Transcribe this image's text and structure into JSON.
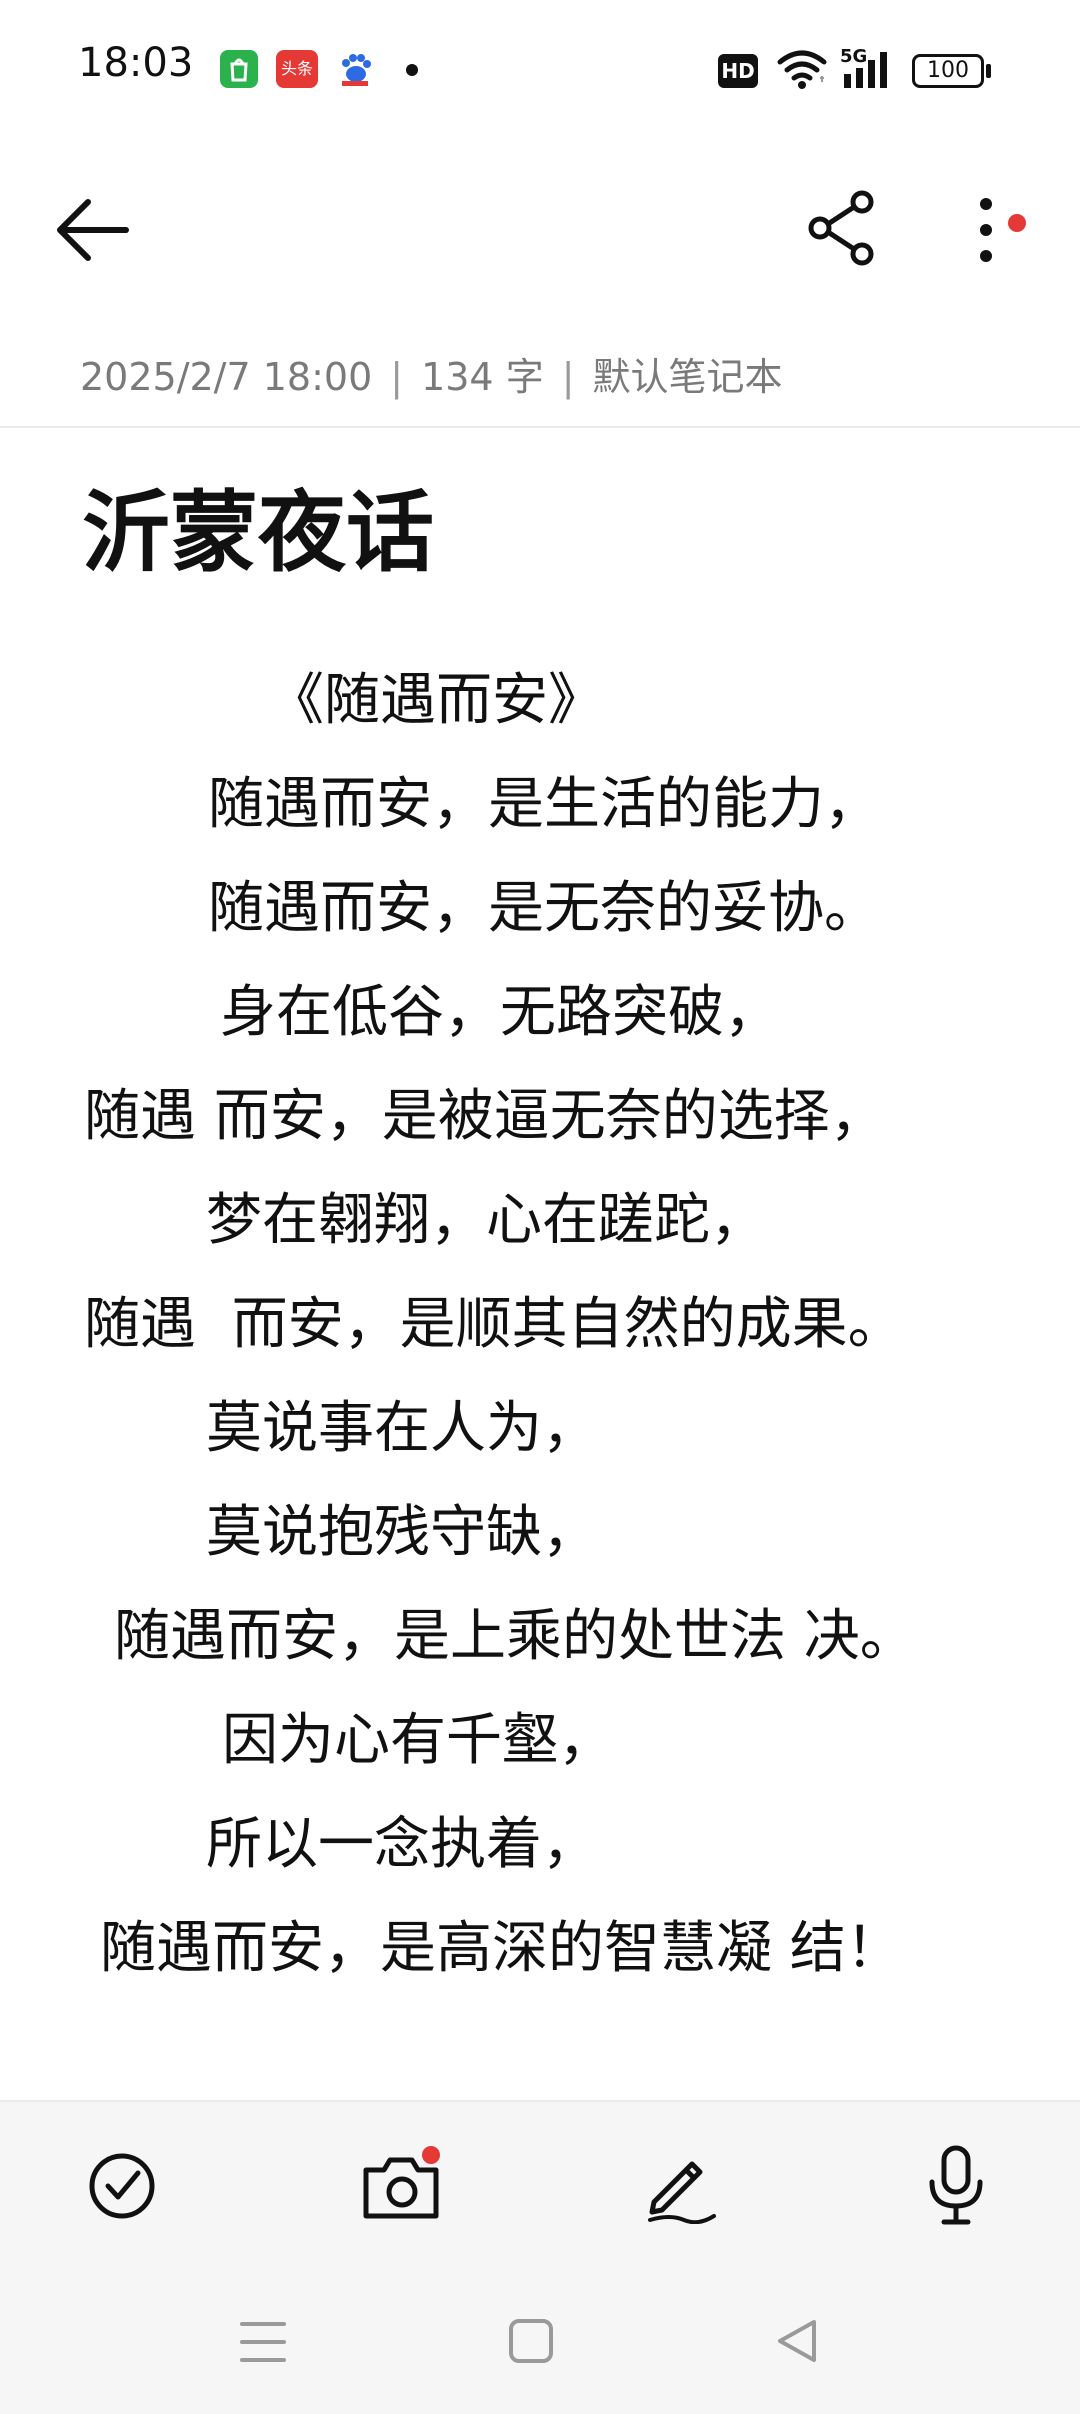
{
  "status_bar": {
    "time": "18:03",
    "app_icons": [
      "shopping-bag-icon",
      "toutiao-app-icon",
      "baidu-app-icon"
    ],
    "toutiao_label": "头条",
    "hd_label": "HD",
    "network_label": "5G",
    "battery_label": "100"
  },
  "note": {
    "date": "2025/2/7 18:00",
    "word_count": "134 字",
    "notebook": "默认笔记本",
    "title": "沂蒙夜话",
    "lines": [
      "《随遇而安》",
      "随遇而安，是生活的能力，",
      "随遇而安，是无奈的妥协。",
      "身在低谷，无路突破，",
      "随遇 而安，是被逼无奈的选择，",
      "梦在翱翔，心在蹉跎，",
      "随遇  而安，是顺其自然的成果。",
      "莫说事在人为，",
      "莫说抱残守缺，",
      "随遇而安，是上乘的处世法 决。",
      "因为心有千壑，",
      "所以一念执着，",
      "随遇而安，是高深的智慧凝 结！"
    ]
  },
  "colors": {
    "accent_red": "#e53935",
    "meta_gray": "#7a7a7a",
    "bottom_bar_bg": "#f6f6f6"
  }
}
